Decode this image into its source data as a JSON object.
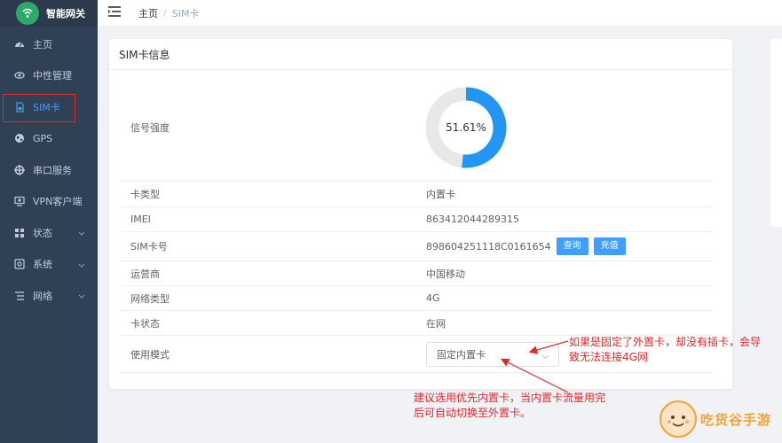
{
  "brand": {
    "title": "智能网关"
  },
  "sidebar": {
    "items": [
      {
        "label": "主页",
        "icon": "dashboard-icon"
      },
      {
        "label": "中性管理",
        "icon": "eye-icon"
      },
      {
        "label": "SIM卡",
        "icon": "sim-icon",
        "active": true
      },
      {
        "label": "GPS",
        "icon": "globe-icon"
      },
      {
        "label": "串口服务",
        "icon": "serial-icon"
      },
      {
        "label": "VPN客户端",
        "icon": "monitor-icon"
      },
      {
        "label": "状态",
        "icon": "grid-icon",
        "expandable": true
      },
      {
        "label": "系统",
        "icon": "settings-box-icon",
        "expandable": true
      },
      {
        "label": "网络",
        "icon": "list-icon",
        "expandable": true
      }
    ]
  },
  "breadcrumb": {
    "home": "主页",
    "separator": "/",
    "current": "SIM卡"
  },
  "card": {
    "title": "SIM卡信息",
    "signal": {
      "label": "信号强度",
      "percent_text": "51.61%",
      "percent": 51.61
    },
    "rows": [
      {
        "label": "卡类型",
        "value": "内置卡"
      },
      {
        "label": "IMEI",
        "value": "863412044289315"
      },
      {
        "label": "SIM卡号",
        "value": "898604251118C0161654",
        "buttons": [
          "查询",
          "充值"
        ]
      },
      {
        "label": "运营商",
        "value": "中国移动"
      },
      {
        "label": "网络类型",
        "value": "4G"
      },
      {
        "label": "卡状态",
        "value": "在网"
      },
      {
        "label": "使用模式",
        "select_value": "固定内置卡"
      }
    ]
  },
  "annotations": {
    "right_line1": "如果是固定了外置卡，却没有插卡，会导",
    "right_line2": "致无法连接4G网",
    "bottom_line1": "建议选用优先内置卡，当内置卡流量用完",
    "bottom_line2": "后可自动切换至外置卡。"
  },
  "watermark": {
    "text": "吃货谷手游"
  },
  "colors": {
    "sidebar": "#304156",
    "accent": "#409eff",
    "annotation": "#e0292b",
    "gauge_track": "#e8e8e8"
  }
}
